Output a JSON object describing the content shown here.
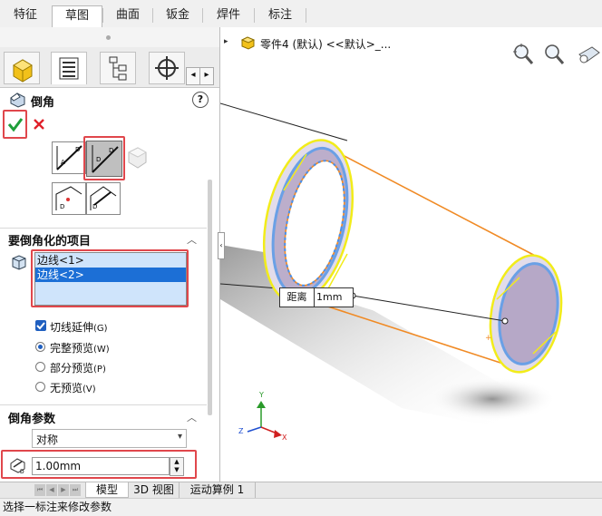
{
  "ribbon_tabs": [
    "特征",
    "草图",
    "曲面",
    "钣金",
    "焊件",
    "标注"
  ],
  "active_ribbon_tab": "草图",
  "tree": {
    "part_label": "零件4 (默认) <<默认>_..."
  },
  "feature": {
    "title": "倒角"
  },
  "items_section": {
    "title": "要倒角化的项目",
    "items": [
      "边线<1>",
      "边线<2>"
    ]
  },
  "options": {
    "tangent_propagation": "切线延伸",
    "tangent_key": "(G)",
    "full_preview": "完整预览",
    "full_key": "(W)",
    "partial_preview": "部分预览",
    "partial_key": "(P)",
    "no_preview": "无预览",
    "no_key": "(V)"
  },
  "params_section": {
    "title": "倒角参数",
    "type_select": "对称",
    "distance_value": "1.00mm"
  },
  "callout": {
    "label": "距离",
    "value": "1mm"
  },
  "bottom_tabs": [
    "模型",
    "3D 视图",
    "运动算例 1"
  ],
  "status_text": "选择一标注来修改参数",
  "colors": {
    "accept": "#1e9e3a",
    "cancel": "#e0202a",
    "highlight": "#e0474c",
    "selection": "#1c6fd6",
    "edge_yellow": "#f2ec1a",
    "edge_orange": "#f08a24"
  }
}
